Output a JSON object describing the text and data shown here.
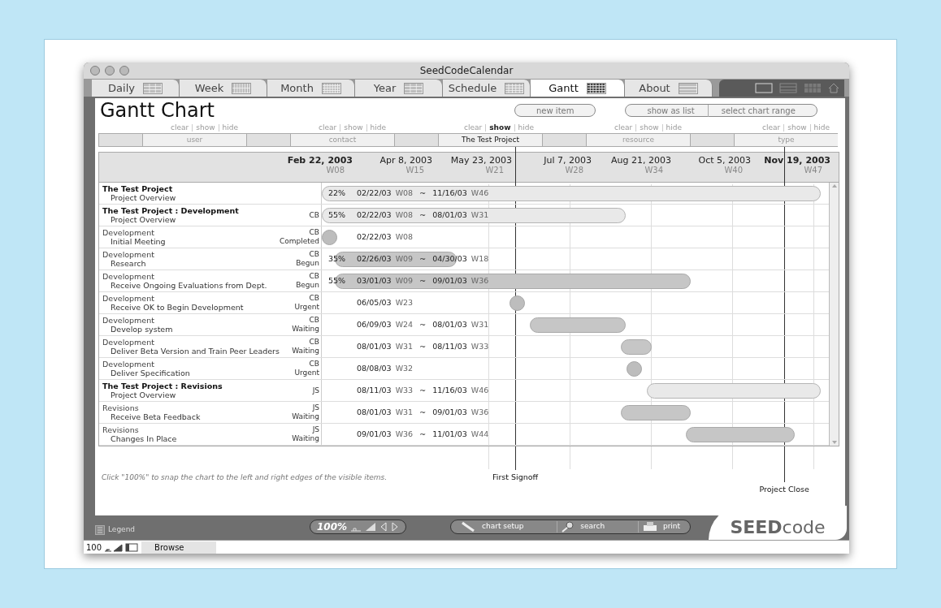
{
  "window": {
    "title": "SeedCodeCalendar"
  },
  "tabs": [
    {
      "label": "Daily",
      "selected": false
    },
    {
      "label": "Week",
      "selected": false
    },
    {
      "label": "Month",
      "selected": false
    },
    {
      "label": "Year",
      "selected": false
    },
    {
      "label": "Schedule",
      "selected": false
    },
    {
      "label": "Gantt",
      "selected": true
    },
    {
      "label": "About",
      "selected": false
    }
  ],
  "page_title": "Gantt Chart",
  "action_groups": [
    {
      "buttons": [
        "new item"
      ]
    },
    {
      "buttons": [
        "show as list",
        "select chart range"
      ]
    }
  ],
  "filters": [
    {
      "placeholder": "user",
      "actions": [
        {
          "label": "clear",
          "selected": false
        },
        {
          "label": "show",
          "selected": false
        },
        {
          "label": "hide",
          "selected": false
        }
      ]
    },
    {
      "placeholder": "contact",
      "actions": [
        {
          "label": "clear",
          "selected": false
        },
        {
          "label": "show",
          "selected": false
        },
        {
          "label": "hide",
          "selected": false
        }
      ]
    },
    {
      "value": "The Test Project",
      "actions": [
        {
          "label": "clear",
          "selected": false
        },
        {
          "label": "show",
          "selected": true
        },
        {
          "label": "hide",
          "selected": false
        }
      ]
    },
    {
      "placeholder": "resource",
      "actions": [
        {
          "label": "clear",
          "selected": false
        },
        {
          "label": "show",
          "selected": false
        },
        {
          "label": "hide",
          "selected": false
        }
      ]
    },
    {
      "placeholder": "type",
      "actions": [
        {
          "label": "clear",
          "selected": false
        },
        {
          "label": "show",
          "selected": false
        },
        {
          "label": "hide",
          "selected": false
        }
      ]
    }
  ],
  "timeline": [
    {
      "date": "Feb 22, 2003",
      "week": "W08",
      "bold": true
    },
    {
      "date": "Apr 8, 2003",
      "week": "W15",
      "bold": false
    },
    {
      "date": "May 23, 2003",
      "week": "W21",
      "bold": false
    },
    {
      "date": "Jul 7, 2003",
      "week": "W28",
      "bold": false
    },
    {
      "date": "Aug 21, 2003",
      "week": "W34",
      "bold": false
    },
    {
      "date": "Oct 5, 2003",
      "week": "W40",
      "bold": false
    },
    {
      "date": "Nov 19, 2003",
      "week": "W47",
      "bold": true
    }
  ],
  "rows": [
    {
      "kind": "summary",
      "group": "The Test Project",
      "title": "Project Overview",
      "percent": "22%",
      "start": "02/22/03",
      "start_week": "W08",
      "separator": "~",
      "end": "11/16/03",
      "end_week": "W46"
    },
    {
      "kind": "summary",
      "group": "The Test Project : Development",
      "title": "Project Overview",
      "resource": "CB",
      "percent": "55%",
      "start": "02/22/03",
      "start_week": "W08",
      "separator": "~",
      "end": "08/01/03",
      "end_week": "W31"
    },
    {
      "kind": "milestone",
      "group": "Development",
      "title": "Initial Meeting",
      "resource": "CB",
      "status": "Completed",
      "start": "02/22/03",
      "start_week": "W08"
    },
    {
      "kind": "task",
      "group": "Development",
      "title": "Research",
      "resource": "CB",
      "status": "Begun",
      "percent": "35%",
      "start": "02/26/03",
      "start_week": "W09",
      "separator": "~",
      "end": "04/30/03",
      "end_week": "W18"
    },
    {
      "kind": "task",
      "group": "Development",
      "title": "Receive Ongoing Evaluations from Dept.",
      "resource": "CB",
      "status": "Begun",
      "percent": "55%",
      "start": "03/01/03",
      "start_week": "W09",
      "separator": "~",
      "end": "09/01/03",
      "end_week": "W36"
    },
    {
      "kind": "milestone",
      "group": "Development",
      "title": "Receive OK to Begin Development",
      "resource": "CB",
      "status": "Urgent",
      "start": "06/05/03",
      "start_week": "W23"
    },
    {
      "kind": "task",
      "group": "Development",
      "title": "Develop system",
      "resource": "CB",
      "status": "Waiting",
      "start": "06/09/03",
      "start_week": "W24",
      "separator": "~",
      "end": "08/01/03",
      "end_week": "W31"
    },
    {
      "kind": "task",
      "group": "Development",
      "title": "Deliver Beta Version and Train Peer Leaders",
      "resource": "CB",
      "status": "Waiting",
      "start": "08/01/03",
      "start_week": "W31",
      "separator": "~",
      "end": "08/11/03",
      "end_week": "W33"
    },
    {
      "kind": "milestone",
      "group": "Development",
      "title": "Deliver Specification",
      "resource": "CB",
      "status": "Urgent",
      "start": "08/08/03",
      "start_week": "W32"
    },
    {
      "kind": "summary",
      "group": "The Test Project : Revisions",
      "title": "Project Overview",
      "resource": "JS",
      "start": "08/11/03",
      "start_week": "W33",
      "separator": "~",
      "end": "11/16/03",
      "end_week": "W46"
    },
    {
      "kind": "task",
      "group": "Revisions",
      "title": "Receive Beta Feedback",
      "resource": "JS",
      "status": "Waiting",
      "start": "08/01/03",
      "start_week": "W31",
      "separator": "~",
      "end": "09/01/03",
      "end_week": "W36"
    },
    {
      "kind": "task",
      "group": "Revisions",
      "title": "Changes In Place",
      "resource": "JS",
      "status": "Waiting",
      "start": "09/01/03",
      "start_week": "W36",
      "separator": "~",
      "end": "11/01/03",
      "end_week": "W44"
    }
  ],
  "markers": [
    {
      "label": "First Signoff",
      "level": 0.39
    },
    {
      "label": "Project Close",
      "level": 0.93
    }
  ],
  "hint": "Click \"100%\" to snap the chart to the left and right edges of the visible items.",
  "legend": "Legend",
  "zoom_control": "100%",
  "footer_buttons": [
    "chart setup",
    "search",
    "print"
  ],
  "logo": {
    "strong": "SEED",
    "light": "code"
  },
  "status_bar": {
    "zoom": "100",
    "mode": "Browse"
  }
}
